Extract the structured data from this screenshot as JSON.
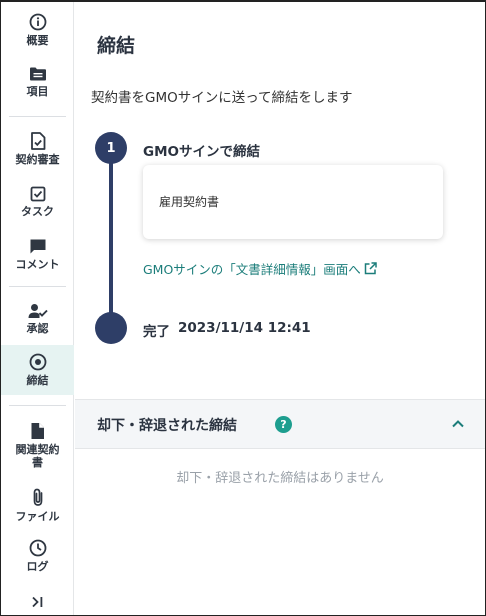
{
  "sidebar": {
    "items": [
      {
        "id": "overview",
        "label": "概要",
        "icon": "info-icon"
      },
      {
        "id": "items",
        "label": "項目",
        "icon": "folder-icon"
      },
      {
        "id": "review",
        "label": "契約審査",
        "icon": "document-check-icon"
      },
      {
        "id": "tasks",
        "label": "タスク",
        "icon": "checkbox-icon"
      },
      {
        "id": "comments",
        "label": "コメント",
        "icon": "comment-icon"
      },
      {
        "id": "approval",
        "label": "承認",
        "icon": "user-check-icon"
      },
      {
        "id": "conclusion",
        "label": "締結",
        "icon": "target-icon",
        "active": true
      },
      {
        "id": "related",
        "label": "関連契約書",
        "icon": "document-icon"
      },
      {
        "id": "files",
        "label": "ファイル",
        "icon": "paperclip-icon"
      },
      {
        "id": "log",
        "label": "ログ",
        "icon": "clock-icon"
      }
    ],
    "collapse_icon": "collapse-right-icon"
  },
  "main": {
    "title": "締結",
    "subtitle": "契約書をGMOサインに送って締結をします",
    "step": {
      "number": "1",
      "title": "GMOサインで締結",
      "document_name": "雇用契約書",
      "link_text": "GMOサインの「文書詳細情報」画面へ"
    },
    "complete": {
      "label": "完了",
      "datetime": "2023/11/14 12:41"
    },
    "rejected_section": {
      "title": "却下・辞退された締結",
      "empty_message": "却下・辞退された締結はありません"
    }
  },
  "colors": {
    "timeline": "#2e3e67",
    "accent": "#1b7d7a",
    "active_bg": "#e6f3f2"
  }
}
